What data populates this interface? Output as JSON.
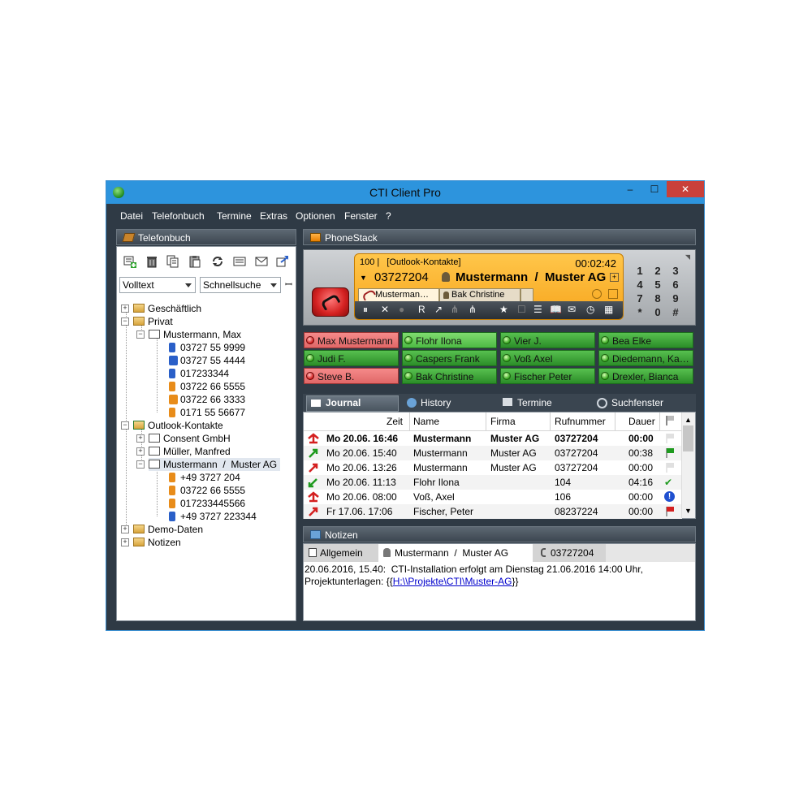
{
  "window": {
    "title": "CTI Client Pro",
    "min": "–",
    "max": "☐",
    "close": "✕"
  },
  "menu": [
    "Datei",
    "Telefonbuch",
    "Termine",
    "Extras",
    "Optionen",
    "Fenster",
    "?"
  ],
  "phonebook": {
    "title": "Telefonbuch",
    "combo1": "Volltext",
    "combo2": "Schnellsuche",
    "pin": "📌",
    "toolbar_icons": [
      "add-contact-icon",
      "trash-icon",
      "copy-icon",
      "paste-icon",
      "refresh-icon",
      "card-icon",
      "mail-icon",
      "export-icon"
    ],
    "tree": {
      "geschaeftlich": "Geschäftlich",
      "privat": "Privat",
      "mustermann_max": "Mustermann, Max",
      "max_numbers": [
        "03727 55 9999",
        "03727 55 4444",
        "017233344",
        "03722 66 5555",
        "03722 66 3333",
        "0171 55 56677"
      ],
      "outlook": "Outlook-Kontakte",
      "consent": "Consent GmbH",
      "mueller": "Müller, Manfred",
      "mustermann_ag": "Mustermann  /  Muster AG",
      "ag_numbers": [
        "+49 3727 204",
        "03722 66 5555",
        "017233445566",
        "+49 3727 223344"
      ],
      "demo": "Demo-Daten",
      "notizen": "Notizen"
    }
  },
  "phonestack": {
    "title": "PhoneStack",
    "line_info": "100 |   [Outlook-Kontakte]",
    "timer": "00:02:42",
    "number": "03727204",
    "caller": "Mustermann  /  Muster AG",
    "tab1": "Musterman…",
    "tab2": "Bak Christine",
    "toolbar": [
      "⏸",
      "✕",
      "●",
      "R",
      "↗",
      "⋔",
      "⋔",
      "★",
      "☐",
      "☰",
      "📖",
      "✉",
      "◷",
      "▦"
    ],
    "keypad": [
      "1",
      "2",
      "3",
      "4",
      "5",
      "6",
      "7",
      "8",
      "9",
      "*",
      "0",
      "#"
    ]
  },
  "blf": [
    {
      "name": "Max Mustermann",
      "status": "red"
    },
    {
      "name": "Flohr Ilona",
      "status": "light"
    },
    {
      "name": "Vier J.",
      "status": "green"
    },
    {
      "name": "Bea Elke",
      "status": "green"
    },
    {
      "name": "Judi F.",
      "status": "green"
    },
    {
      "name": "Caspers Frank",
      "status": "green"
    },
    {
      "name": "Voß Axel",
      "status": "green"
    },
    {
      "name": "Diedemann, Ka…",
      "status": "green"
    },
    {
      "name": "Steve B.",
      "status": "red"
    },
    {
      "name": "Bak Christine",
      "status": "green"
    },
    {
      "name": "Fischer Peter",
      "status": "green"
    },
    {
      "name": "Drexler, Bianca",
      "status": "green"
    }
  ],
  "tabs": {
    "journal": "Journal",
    "history": "History",
    "termine": "Termine",
    "suchfenster": "Suchfenster"
  },
  "journal": {
    "headers": {
      "zeit": "Zeit",
      "name": "Name",
      "firma": "Firma",
      "rufnummer": "Rufnummer",
      "dauer": "Dauer"
    },
    "rows": [
      {
        "zeit": "Mo 20.06. 16:46",
        "name": "Mustermann",
        "firma": "Muster AG",
        "nr": "03727204",
        "dauer": "00:00",
        "dir": "missed",
        "flag": "none",
        "bold": true
      },
      {
        "zeit": "Mo 20.06. 15:40",
        "name": "Mustermann",
        "firma": "Muster AG",
        "nr": "03727204",
        "dauer": "00:38",
        "dir": "out-green",
        "flag": "green",
        "bold": false
      },
      {
        "zeit": "Mo 20.06. 13:26",
        "name": "Mustermann",
        "firma": "Muster AG",
        "nr": "03727204",
        "dauer": "00:00",
        "dir": "out-red",
        "flag": "none",
        "bold": false
      },
      {
        "zeit": "Mo 20.06. 11:13",
        "name": "Flohr Ilona",
        "firma": "",
        "nr": "104",
        "dauer": "04:16",
        "dir": "in-green",
        "flag": "check",
        "bold": false
      },
      {
        "zeit": "Mo 20.06. 08:00",
        "name": "Voß, Axel",
        "firma": "",
        "nr": "106",
        "dauer": "00:00",
        "dir": "missed",
        "flag": "info",
        "bold": false
      },
      {
        "zeit": "Fr 17.06. 17:06",
        "name": "Fischer, Peter",
        "firma": "",
        "nr": "08237224",
        "dauer": "00:00",
        "dir": "out-red",
        "flag": "red",
        "bold": false
      }
    ]
  },
  "notes": {
    "title": "Notizen",
    "tab_allgemein": "Allgemein",
    "tab_contact": "Mustermann  /  Muster AG",
    "tab_number": "03727204",
    "line1": "20.06.2016, 15.40:  CTI-Installation erfolgt am Dienstag 21.06.2016 14:00 Uhr,",
    "line2_prefix": "Projektunterlagen: {{",
    "link": "H:\\\\Projekte\\CTI\\Muster-AG",
    "line2_suffix": "}}"
  }
}
